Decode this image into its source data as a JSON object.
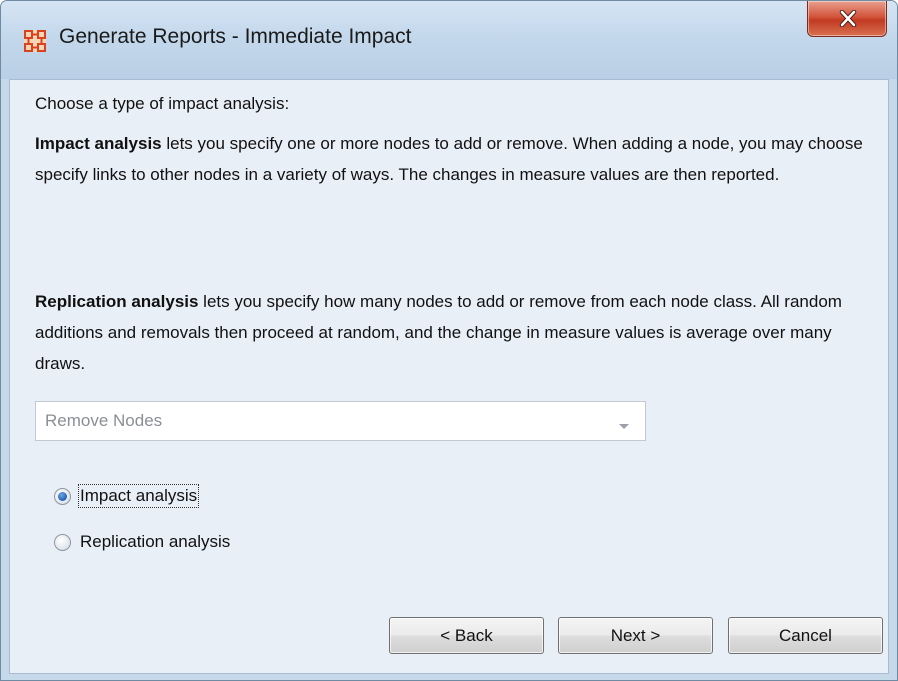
{
  "window": {
    "title": "Generate Reports - Immediate Impact"
  },
  "content": {
    "intro": "Choose a type of impact analysis:",
    "impact_heading": "Impact analysis",
    "impact_text": " lets you specify one or more nodes to add or remove. When adding a node, you may choose specify links to other nodes in a variety of ways. The changes in measure values are then reported.",
    "replication_heading": "Replication analysis",
    "replication_text": " lets you specify how many nodes to add or remove from each node class. All random additions and removals then proceed at random, and the change in measure values is average over many draws."
  },
  "combo": {
    "selected": "Remove Nodes",
    "enabled": false
  },
  "options": {
    "impact_label": "Impact analysis",
    "impact_checked": true,
    "replication_label": "Replication analysis",
    "replication_checked": false
  },
  "buttons": {
    "back": "< Back",
    "next": "Next >",
    "cancel": "Cancel"
  },
  "colors": {
    "frame": "#c6d9ea",
    "client": "#e9eff6",
    "close_button": "#c23a22",
    "app_icon": "#d8421f"
  }
}
